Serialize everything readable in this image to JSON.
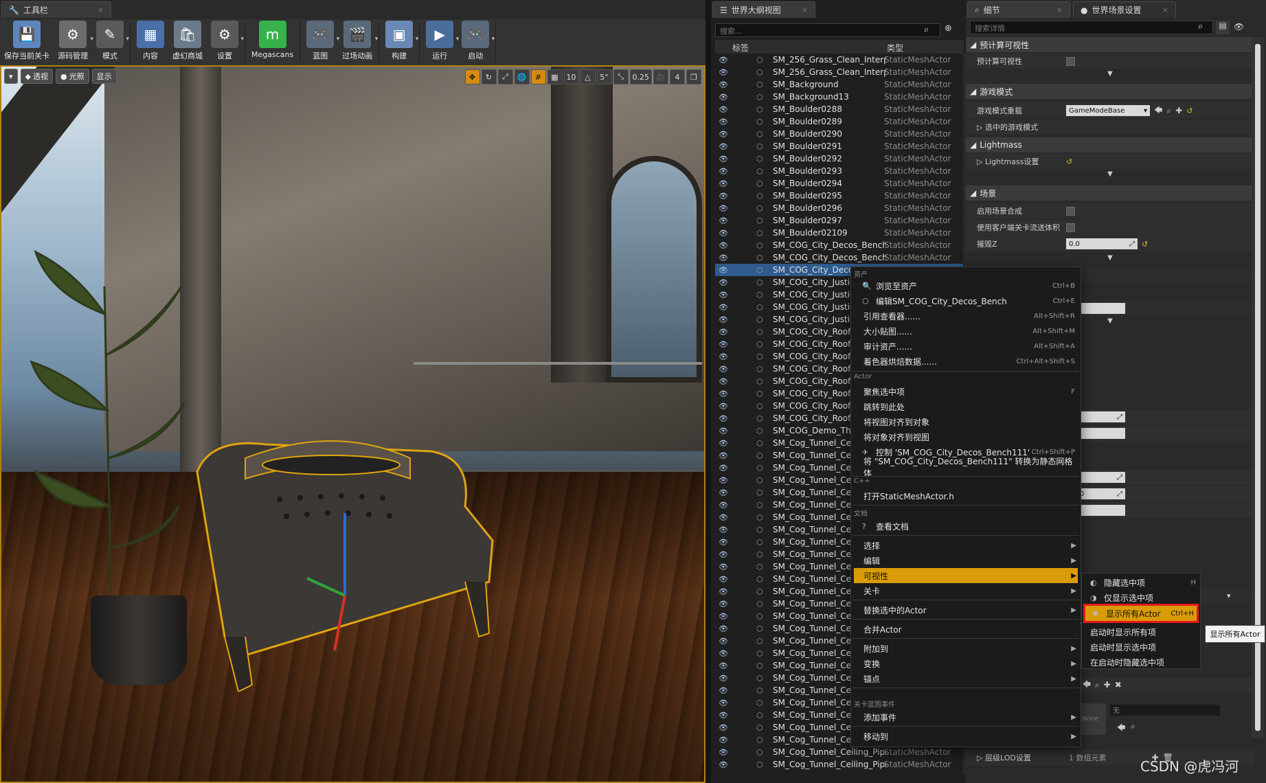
{
  "toolbar": {
    "tab_title": "工具栏",
    "buttons": [
      {
        "label": "保存当前关卡",
        "color": "#5d86bf",
        "glyph": "💾"
      },
      {
        "label": "源码管理",
        "color": "#6c6c6c",
        "glyph": "⚙"
      },
      {
        "label": "模式",
        "color": "#5a5a5a",
        "glyph": "✎"
      },
      {
        "label": "内容",
        "color": "#4a6fa8",
        "glyph": "▦"
      },
      {
        "label": "虚幻商城",
        "color": "#6b7b8a",
        "glyph": "🛍"
      },
      {
        "label": "设置",
        "color": "#5a5a5a",
        "glyph": "⚙"
      },
      {
        "label": "Megascans",
        "color": "#35b34a",
        "glyph": "m"
      },
      {
        "label": "蓝图",
        "color": "#5a6a7a",
        "glyph": "🎮"
      },
      {
        "label": "过场动画",
        "color": "#5a6a7a",
        "glyph": "🎬"
      },
      {
        "label": "构建",
        "color": "#6a88b4",
        "glyph": "▣"
      },
      {
        "label": "运行",
        "color": "#4b6d9a",
        "glyph": "▶"
      },
      {
        "label": "启动",
        "color": "#5a6a7a",
        "glyph": "🎮"
      }
    ]
  },
  "viewport": {
    "perspective": "透视",
    "lit": "光照",
    "show": "显示",
    "grid_snap": "10",
    "rot_snap": "5°",
    "scale_snap": "0.25",
    "cam_speed": "4"
  },
  "outliner": {
    "tab_title": "世界大纲视图",
    "search_placeholder": "搜索...",
    "col_label": "标签",
    "col_type": "类型",
    "rows": [
      {
        "name": "SM_256_Grass_Clean_InterpA",
        "type": "StaticMeshActor"
      },
      {
        "name": "SM_256_Grass_Clean_InterpA",
        "type": "StaticMeshActor"
      },
      {
        "name": "SM_Background",
        "type": "StaticMeshActor"
      },
      {
        "name": "SM_Background13",
        "type": "StaticMeshActor"
      },
      {
        "name": "SM_Boulder0288",
        "type": "StaticMeshActor"
      },
      {
        "name": "SM_Boulder0289",
        "type": "StaticMeshActor"
      },
      {
        "name": "SM_Boulder0290",
        "type": "StaticMeshActor"
      },
      {
        "name": "SM_Boulder0291",
        "type": "StaticMeshActor"
      },
      {
        "name": "SM_Boulder0292",
        "type": "StaticMeshActor"
      },
      {
        "name": "SM_Boulder0293",
        "type": "StaticMeshActor"
      },
      {
        "name": "SM_Boulder0294",
        "type": "StaticMeshActor"
      },
      {
        "name": "SM_Boulder0295",
        "type": "StaticMeshActor"
      },
      {
        "name": "SM_Boulder0296",
        "type": "StaticMeshActor"
      },
      {
        "name": "SM_Boulder0297",
        "type": "StaticMeshActor"
      },
      {
        "name": "SM_Boulder02109",
        "type": "StaticMeshActor"
      },
      {
        "name": "SM_COG_City_Decos_Bench",
        "type": "StaticMeshActor"
      },
      {
        "name": "SM_COG_City_Decos_Bench11",
        "type": "StaticMeshActor"
      },
      {
        "name": "SM_COG_City_Decos_Bench11",
        "type": "StaticMeshActor"
      },
      {
        "name": "SM_COG_City_Justice",
        "type": ""
      },
      {
        "name": "SM_COG_City_Justice",
        "type": ""
      },
      {
        "name": "SM_COG_City_Justice",
        "type": ""
      },
      {
        "name": "SM_COG_City_Justice",
        "type": ""
      },
      {
        "name": "SM_COG_City_Roof_Tr",
        "type": ""
      },
      {
        "name": "SM_COG_City_Roof_Tr",
        "type": ""
      },
      {
        "name": "SM_COG_City_Roof_Tr",
        "type": ""
      },
      {
        "name": "SM_COG_City_Roof_Tr",
        "type": ""
      },
      {
        "name": "SM_COG_City_Roof_Tr",
        "type": ""
      },
      {
        "name": "SM_COG_City_Roof_Tr",
        "type": ""
      },
      {
        "name": "SM_COG_City_Roof_Tr",
        "type": ""
      },
      {
        "name": "SM_COG_City_Roof_Tr",
        "type": ""
      },
      {
        "name": "SM_COG_Demo_Theat",
        "type": ""
      },
      {
        "name": "SM_Cog_Tunnel_Ceilin",
        "type": ""
      },
      {
        "name": "SM_Cog_Tunnel_Ceilin",
        "type": ""
      },
      {
        "name": "SM_Cog_Tunnel_Ceilin",
        "type": ""
      },
      {
        "name": "SM_Cog_Tunnel_Ceilin",
        "type": ""
      },
      {
        "name": "SM_Cog_Tunnel_Ceilin",
        "type": ""
      },
      {
        "name": "SM_Cog_Tunnel_Ceilin",
        "type": ""
      },
      {
        "name": "SM_Cog_Tunnel_Ceilin",
        "type": ""
      },
      {
        "name": "SM_Cog_Tunnel_Ceilin",
        "type": ""
      },
      {
        "name": "SM_Cog_Tunnel_Ceilin",
        "type": ""
      },
      {
        "name": "SM_Cog_Tunnel_Ceilin",
        "type": ""
      },
      {
        "name": "SM_Cog_Tunnel_Ceilin",
        "type": ""
      },
      {
        "name": "SM_Cog_Tunnel_Ceilin",
        "type": ""
      },
      {
        "name": "SM_Cog_Tunnel_Ceilin",
        "type": ""
      },
      {
        "name": "SM_Cog_Tunnel_Ceilin",
        "type": ""
      },
      {
        "name": "SM_Cog_Tunnel_Ceilin",
        "type": ""
      },
      {
        "name": "SM_Cog_Tunnel_Ceilin",
        "type": ""
      },
      {
        "name": "SM_Cog_Tunnel_Ceilin",
        "type": ""
      },
      {
        "name": "SM_Cog_Tunnel_Ceilin",
        "type": ""
      },
      {
        "name": "SM_Cog_Tunnel_Ceilin",
        "type": ""
      },
      {
        "name": "SM_Cog_Tunnel_Ceilin",
        "type": ""
      },
      {
        "name": "SM_Cog_Tunnel_Ceilin",
        "type": ""
      },
      {
        "name": "SM_Cog_Tunnel_Ceilin",
        "type": ""
      },
      {
        "name": "SM_Cog_Tunnel_Ceilin",
        "type": ""
      },
      {
        "name": "SM_Cog_Tunnel_Ceilin",
        "type": ""
      },
      {
        "name": "SM_Cog_Tunnel_Ceiling_Pipes",
        "type": "StaticMeshActor"
      },
      {
        "name": "SM_Cog_Tunnel_Ceiling_Pipes",
        "type": "StaticMeshActor"
      },
      {
        "name": "SM_Cog_Tunnel_Ceiling_Pipes",
        "type": "StaticMeshActor"
      }
    ],
    "selected_index": 17
  },
  "details": {
    "tab1": "细节",
    "tab2": "世界场景设置",
    "search_placeholder": "搜索详情",
    "sec_precomp": "预计算可视性",
    "prop_precomp": "预计算可视性",
    "sec_gamemode": "游戏模式",
    "prop_gm_override": "游戏模式重载",
    "gm_value": "GameModeBase",
    "prop_selected_gm": "选中的游戏模式",
    "sec_lightmass": "Lightmass",
    "prop_lightmass": "Lightmass设置",
    "sec_scene": "场景",
    "prop_scene_comp": "启用场景合成",
    "prop_client_vol": "使用客户端关卡流送体积",
    "prop_killz": "摧毁Z",
    "killz_value": "0.0",
    "frag_v1": "0",
    "frag_v2": "0",
    "frag_v3": "00.0",
    "frag_none": "None",
    "frag_wu": "无",
    "prop_lod": "层级LOD设置",
    "lod_value": "1 数组元素"
  },
  "context_menu": {
    "head_asset": "资产",
    "browse": "浏览至资产",
    "browse_sc": "Ctrl+B",
    "edit": "编辑SM_COG_City_Decos_Bench",
    "edit_sc": "Ctrl+E",
    "refviewer": "引用查看器......",
    "refviewer_sc": "Alt+Shift+R",
    "sizemap": "大小贴图......",
    "sizemap_sc": "Alt+Shift+M",
    "audit": "审计资产......",
    "audit_sc": "Alt+Shift+A",
    "shader": "着色器烘焙数据......",
    "shader_sc": "Ctrl+Alt+Shift+S",
    "head_actor": "Actor",
    "focus": "聚焦选中项",
    "focus_sc": "F",
    "goto": "跳转到此处",
    "snap_view": "将视图对齐到对象",
    "snap_obj": "将对象对齐到视图",
    "pilot": "控制 'SM_COG_City_Decos_Bench111'",
    "pilot_sc": "Ctrl+Shift+P",
    "convert": "将 \"SM_COG_City_Decos_Bench111\" 转换为静态网格体",
    "head_cpp": "C++",
    "open_h": "打开StaticMeshActor.h",
    "head_doc": "文档",
    "docs": "查看文档",
    "select": "选择",
    "edit_menu": "编辑",
    "visibility": "可视性",
    "level": "关卡",
    "replace": "替换选中的Actor",
    "merge": "合并Actor",
    "attach": "附加到",
    "transform": "变换",
    "pivot": "锚点",
    "head_lvlbp": "关卡蓝图事件",
    "add_event": "添加事件",
    "move_to": "移动到"
  },
  "submenu": {
    "hide_sel": "隐藏选中项",
    "hide_sel_sc": "H",
    "show_only": "仅显示选中项",
    "show_all": "显示所有Actor",
    "show_all_sc": "Ctrl+H",
    "startup_show_all": "启动时显示所有项",
    "startup_show_sel": "启动时显示选中项",
    "startup_hide_sel": "在启动时隐藏选中项"
  },
  "tooltip": "显示所有Actor",
  "watermark": "CSDN @虎冯河"
}
